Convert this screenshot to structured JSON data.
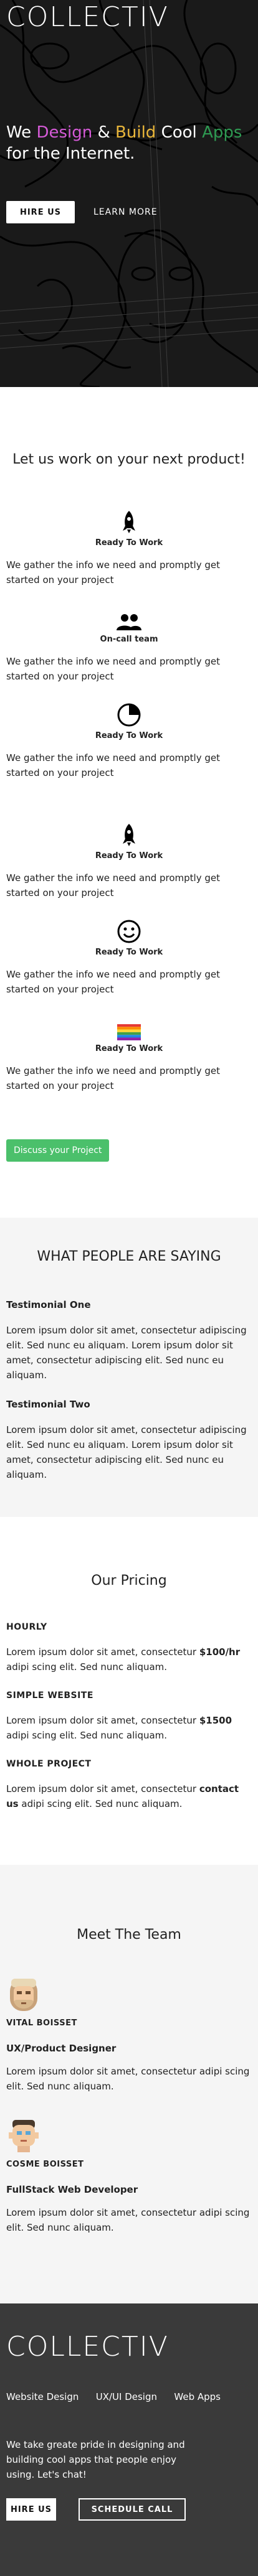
{
  "hero": {
    "brand": "COLLECTIV",
    "tagline": {
      "we": "We ",
      "design": "Design",
      "amp": " & ",
      "build": "Build",
      "cool": " Cool ",
      "apps": "Apps",
      "rest": "for the Internet."
    },
    "hire_label": "HIRE US",
    "learn_label": "LEARN MORE"
  },
  "services": {
    "heading": "Let us work on your next product!",
    "items": [
      {
        "icon": "rocket-icon",
        "title": "Ready To Work",
        "text": "We gather the info we need and promptly get started on your project"
      },
      {
        "icon": "people-icon",
        "title": "On-call team",
        "text": "We gather the info we need and promptly get started on your project"
      },
      {
        "icon": "pie-chart-icon",
        "title": "Ready To Work",
        "text": "We gather the info we need and promptly get started on your project"
      },
      {
        "icon": "rocket-icon",
        "title": "Ready To Work",
        "text": "We gather the info we need and promptly get started on your project"
      },
      {
        "icon": "smiley-icon",
        "title": "Ready To Work",
        "text": "We gather the info we need and promptly get started on your project"
      },
      {
        "icon": "rainbow-flag-icon",
        "title": "Ready To Work",
        "text": "We gather the info we need and promptly get started on your project"
      }
    ],
    "cta_label": "Discuss your Project"
  },
  "testimonials": {
    "heading": "WHAT PEOPLE ARE SAYING",
    "items": [
      {
        "title": "Testimonial One",
        "text": "Lorem ipsum dolor sit amet, consectetur adipiscing elit. Sed nunc eu aliquam. Lorem ipsum dolor sit amet, consectetur adipiscing elit. Sed nunc eu aliquam."
      },
      {
        "title": "Testimonial Two",
        "text": "Lorem ipsum dolor sit amet, consectetur adipiscing elit. Sed nunc eu aliquam. Lorem ipsum dolor sit amet, consectetur adipiscing elit. Sed nunc eu aliquam."
      }
    ]
  },
  "pricing": {
    "heading": "Our Pricing",
    "plans": [
      {
        "name": "HOURLY",
        "before": "Lorem ipsum dolor sit amet, consectetur ",
        "price": "$100/hr",
        "after": " adipi scing elit. Sed nunc aliquam."
      },
      {
        "name": "SIMPLE WEBSITE",
        "before": "Lorem ipsum dolor sit amet, consectetur ",
        "price": "$1500",
        "after": " adipi scing elit. Sed nunc aliquam."
      },
      {
        "name": "WHOLE PROJECT",
        "before": "Lorem ipsum dolor sit amet, consectetur ",
        "price": "contact us",
        "after": " adipi scing elit. Sed nunc aliquam."
      }
    ]
  },
  "team": {
    "heading": "Meet The Team",
    "members": [
      {
        "name": "VITAL BOISSET",
        "role": "UX/Product Designer",
        "bio": "Lorem ipsum dolor sit amet, consectetur adipi scing elit. Sed nunc aliquam."
      },
      {
        "name": "COSME BOISSET",
        "role": "FullStack Web Developer",
        "bio": "Lorem ipsum dolor sit amet, consectetur adipi scing elit. Sed nunc aliquam."
      }
    ]
  },
  "footer": {
    "brand": "COLLECTIV",
    "nav": [
      "Website Design",
      "UX/UI Design",
      "Web Apps"
    ],
    "pitch": "We take greate pride in designing and building cool apps that people enjoy using. Let's chat!",
    "hire_label": "HIRE US",
    "schedule_label": "SCHEDULE CALL"
  },
  "colors": {
    "accent_green": "#4bc06b",
    "footer_bg": "#3a3a3a",
    "design": "#d45ad6",
    "build": "#e9b63a",
    "apps": "#2e9a52"
  }
}
